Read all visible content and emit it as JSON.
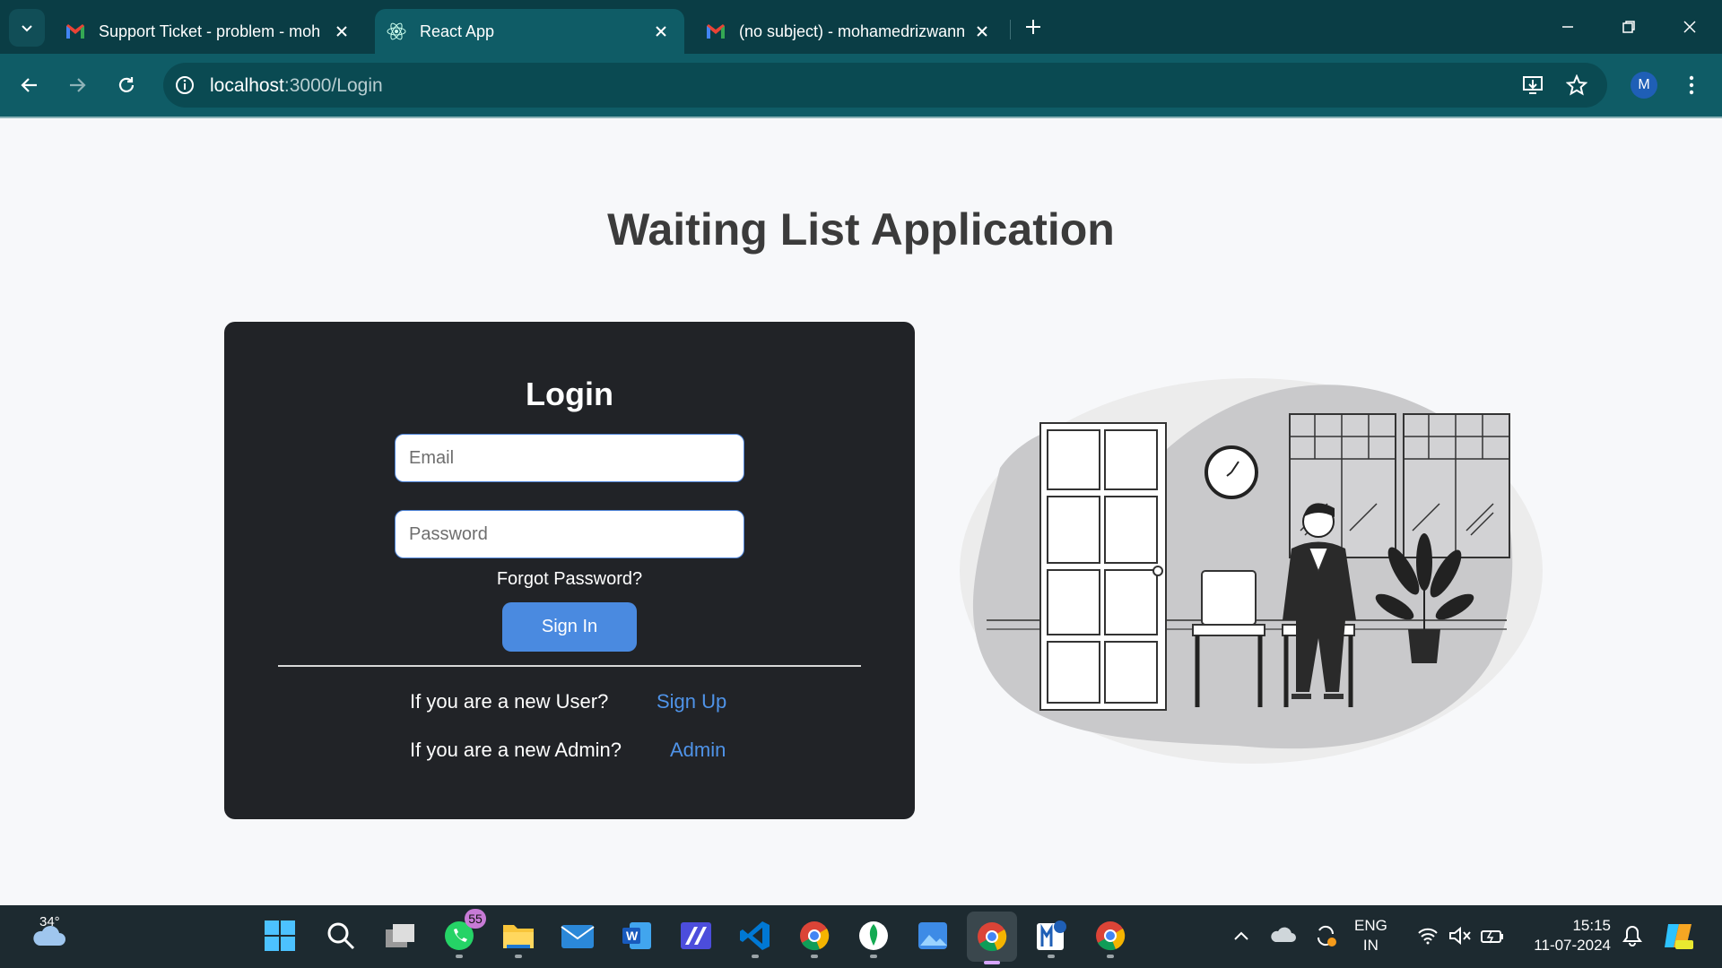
{
  "browser": {
    "tabs": [
      {
        "title": "Support Ticket - problem - moh",
        "icon": "gmail-icon",
        "active": false
      },
      {
        "title": "React App",
        "icon": "react-icon",
        "active": true
      },
      {
        "title": "(no subject) - mohamedrizwann",
        "icon": "gmail-icon",
        "active": false
      }
    ],
    "url_host": "localhost",
    "url_rest": ":3000/Login",
    "profile_initial": "M"
  },
  "page": {
    "title": "Waiting List Application",
    "login": {
      "heading": "Login",
      "email_placeholder": "Email",
      "email_value": "",
      "password_placeholder": "Password",
      "password_value": "",
      "forgot_label": "Forgot Password?",
      "signin_label": "Sign In",
      "new_user_question": "If you are a new User?",
      "signup_label": "Sign Up",
      "new_admin_question": "If you are a new Admin?",
      "admin_label": "Admin"
    },
    "illustration": "waiting-room-illustration"
  },
  "taskbar": {
    "weather_temp": "34°",
    "whatsapp_badge": "55",
    "language": "ENG",
    "region": "IN",
    "time": "15:15",
    "date": "11-07-2024",
    "apps": [
      "windows-start-icon",
      "search-icon",
      "task-view-icon",
      "whatsapp-icon",
      "file-explorer-icon",
      "mail-icon",
      "word-icon",
      "app-icon",
      "vscode-icon",
      "chrome-icon",
      "mongodb-icon",
      "photos-icon",
      "chrome-active-icon",
      "app-m-icon",
      "chrome-profile-icon"
    ]
  },
  "colors": {
    "chrome_dark": "#0a3d45",
    "chrome_toolbar": "#0f5c66",
    "card_bg": "#212327",
    "button_blue": "#4a8ae0",
    "link_blue": "#4f93e8"
  }
}
